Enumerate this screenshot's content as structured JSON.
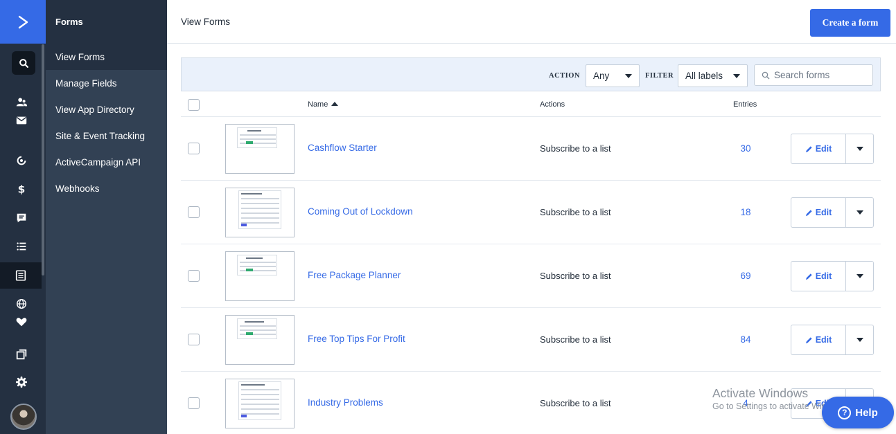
{
  "colors": {
    "brand": "#356ae6",
    "rail": "#243041",
    "subnav": "#324154",
    "link": "#356ae6"
  },
  "rail": {
    "icons": [
      "arrow-logo-icon",
      "search-icon",
      "contacts-icon",
      "email-icon",
      "automation-icon",
      "deals-dollar-icon",
      "conversations-icon",
      "lists-icon",
      "forms-icon",
      "website-globe-icon",
      "heart-icon",
      "pages-icon",
      "settings-gear-icon",
      "avatar"
    ]
  },
  "subnav": {
    "title": "Forms",
    "items": [
      {
        "label": "View Forms",
        "active": true
      },
      {
        "label": "Manage Fields"
      },
      {
        "label": "View App Directory"
      },
      {
        "label": "Site & Event Tracking"
      },
      {
        "label": "ActiveCampaign API"
      },
      {
        "label": "Webhooks"
      }
    ]
  },
  "header": {
    "title": "View Forms",
    "create_label": "Create a form"
  },
  "filters": {
    "action_label": "ACTION",
    "action_value": "Any",
    "filter_label": "FILTER",
    "filter_value": "All labels",
    "search_placeholder": "Search forms"
  },
  "table": {
    "columns": {
      "name": "Name",
      "actions": "Actions",
      "entries": "Entries"
    },
    "edit_label": "Edit",
    "rows": [
      {
        "name": "Cashflow Starter",
        "action": "Subscribe to a list",
        "entries": "30"
      },
      {
        "name": "Coming Out of Lockdown",
        "action": "Subscribe to a list",
        "entries": "18"
      },
      {
        "name": "Free Package Planner",
        "action": "Subscribe to a list",
        "entries": "69"
      },
      {
        "name": "Free Top Tips For Profit",
        "action": "Subscribe to a list",
        "entries": "84"
      },
      {
        "name": "Industry Problems",
        "action": "Subscribe to a list",
        "entries": "4"
      }
    ]
  },
  "watermark": {
    "line1": "Activate Windows",
    "line2": "Go to Settings to activate Windows."
  },
  "help": {
    "label": "Help"
  }
}
